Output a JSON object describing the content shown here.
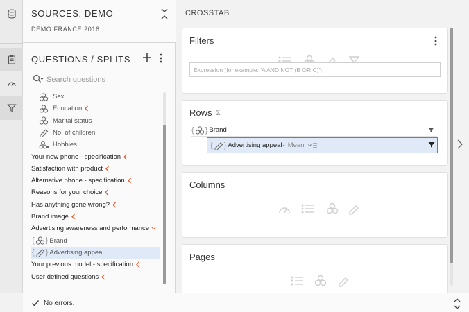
{
  "sources": {
    "title": "SOURCES: DEMO",
    "subtitle": "DEMO FRANCE 2016"
  },
  "questions": {
    "title": "QUESTIONS / SPLITS",
    "search_placeholder": "Search questions",
    "items": [
      {
        "label": "Sex",
        "kind": "categorical",
        "level": "child",
        "chevron": false
      },
      {
        "label": "Education",
        "kind": "categorical",
        "level": "child",
        "chevron": true
      },
      {
        "label": "Marital status",
        "kind": "categorical",
        "level": "child",
        "chevron": false
      },
      {
        "label": "No. of children",
        "kind": "numeric",
        "level": "child",
        "chevron": false
      },
      {
        "label": "Hobbies",
        "kind": "multi",
        "level": "child",
        "chevron": false
      },
      {
        "label": "Your new phone - specification",
        "level": "top",
        "chevron": true
      },
      {
        "label": "Satisfaction with product",
        "level": "top",
        "chevron": true
      },
      {
        "label": "Alternative phone - specification",
        "level": "top",
        "chevron": true
      },
      {
        "label": "Reasons for your choice",
        "level": "top",
        "chevron": true
      },
      {
        "label": "Has anything gone wrong?",
        "level": "top",
        "chevron": true
      },
      {
        "label": "Brand image",
        "level": "top",
        "chevron": true
      },
      {
        "label": "Advertising awareness and performance",
        "level": "top",
        "chevron": "down"
      },
      {
        "label": "Brand",
        "kind": "categorical",
        "level": "split",
        "chevron": false
      },
      {
        "label": "Advertising appeal",
        "kind": "numeric",
        "level": "split",
        "chevron": false,
        "selected": true
      },
      {
        "label": "Your previous model - specification",
        "level": "top",
        "chevron": true
      },
      {
        "label": "User defined questions",
        "level": "top",
        "chevron": true
      }
    ]
  },
  "crosstab": {
    "title": "CROSSTAB",
    "filters": {
      "title": "Filters",
      "placeholder": "Expression (for example: 'A AND NOT (B OR C)')"
    },
    "rows": {
      "title": "Rows",
      "sigma": "Σ",
      "brand": "Brand",
      "nested": {
        "label": "Advertising appeal",
        "separator": "-",
        "stat": "Mean"
      }
    },
    "columns": {
      "title": "Columns"
    },
    "pages": {
      "title": "Pages"
    }
  },
  "status": {
    "text": "No errors."
  },
  "colors": {
    "accent": "#e05a2b",
    "selected_bg": "#dfe9f7",
    "icon": "#666666",
    "ghost_icon": "#cfcfcf"
  }
}
